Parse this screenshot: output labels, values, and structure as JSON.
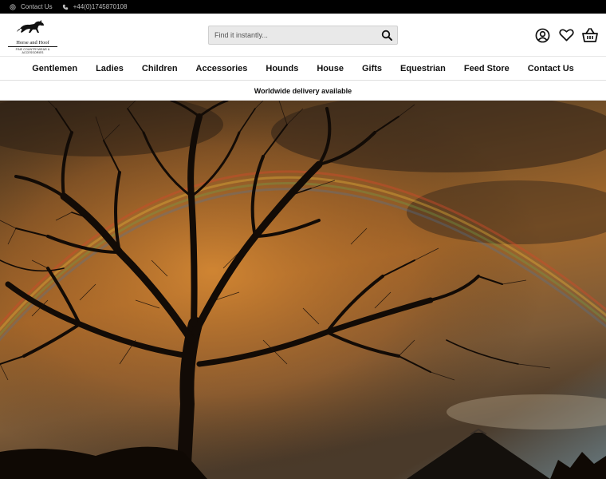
{
  "topbar": {
    "contact_label": "Contact Us",
    "phone": "+44(0)1745870108"
  },
  "header": {
    "logo_brand": "Horse and Hoof",
    "logo_tagline": "FINE COUNTRYWEAR & ACCESSORIES",
    "search_placeholder": "Find it instantly...",
    "icons": [
      "account-icon",
      "wishlist-heart-icon",
      "basket-icon"
    ]
  },
  "nav": {
    "items": [
      "Gentlemen",
      "Ladies",
      "Children",
      "Accessories",
      "Hounds",
      "House",
      "Gifts",
      "Equestrian",
      "Feed Store",
      "Contact Us"
    ]
  },
  "promo": {
    "text": "Worldwide delivery available"
  },
  "hero": {
    "image": "tree-silhouette-rainbow-sunset"
  },
  "colors": {
    "topbar_bg": "#000000",
    "accent": "#111111",
    "search_bg": "#e9e9e9"
  }
}
